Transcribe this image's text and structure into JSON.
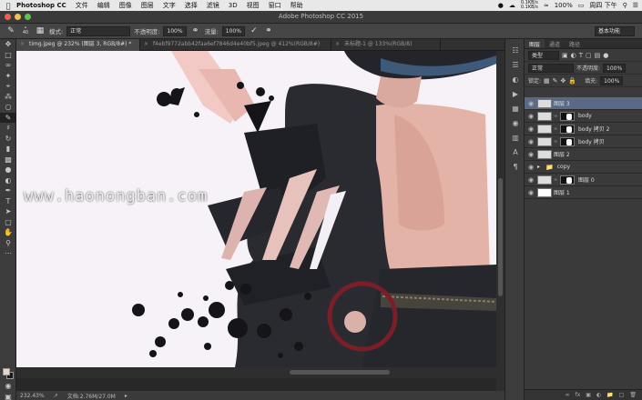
{
  "menubar": {
    "app_name": "Photoshop CC",
    "items": [
      "文件",
      "编辑",
      "图像",
      "图层",
      "文字",
      "选择",
      "滤镜",
      "3D",
      "视图",
      "窗口",
      "帮助"
    ],
    "net_up": "0.1KB/s",
    "net_down": "0.1KB/s",
    "battery": "100%",
    "clock": "周四 下午"
  },
  "window": {
    "title": "Adobe Photoshop CC 2015"
  },
  "options": {
    "brush_size": "40",
    "mode_label": "模式:",
    "mode_value": "正常",
    "opacity_label": "不透明度:",
    "opacity_value": "100%",
    "flow_label": "流量:",
    "flow_value": "100%",
    "workspace": "基本功能"
  },
  "tabs": [
    {
      "label": "timg.jpeg @ 232% (图层 3, RGB/8#) *",
      "active": true
    },
    {
      "label": "f4ebf9772abb42faa6ef7846d4e40bf5.jpeg @ 412%(RGB/8#)",
      "active": false
    },
    {
      "label": "未标题-1 @ 133%(RGB/8)",
      "active": false
    }
  ],
  "canvas": {
    "watermark": "www.haonongban.com"
  },
  "status": {
    "zoom": "232.43%",
    "doc": "文档:2.76M/27.0M"
  },
  "panel": {
    "tabs": [
      "图层",
      "通道",
      "路径"
    ],
    "filter_label": "类型",
    "blend_value": "正常",
    "opacity_label": "不透明度:",
    "opacity_value": "100%",
    "lock_label": "锁定:",
    "fill_label": "填充:",
    "fill_value": "100%",
    "layers": [
      {
        "name": "图层 3",
        "type": "image",
        "selected": true
      },
      {
        "name": "body",
        "type": "masked",
        "selected": false
      },
      {
        "name": "body 拷贝 2",
        "type": "masked",
        "selected": false
      },
      {
        "name": "body 拷贝",
        "type": "masked",
        "selected": false
      },
      {
        "name": "图层 2",
        "type": "image",
        "selected": false
      },
      {
        "name": "copy",
        "type": "group",
        "selected": false
      },
      {
        "name": "图层 0",
        "type": "masked",
        "selected": false
      },
      {
        "name": "图层 1",
        "type": "image",
        "selected": false
      }
    ]
  },
  "colors": {
    "foreground": "#ead6cf",
    "background": "#1a1a1a",
    "selection": "#5a6a86"
  }
}
